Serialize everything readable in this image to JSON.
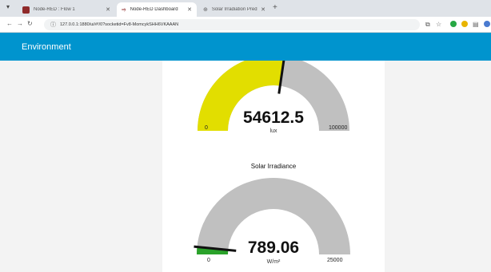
{
  "browser": {
    "tabs": [
      {
        "title": "Node-RED : Flow 1"
      },
      {
        "title": "Node-RED Dashboard"
      },
      {
        "title": "Solar Irradiation Prediction"
      }
    ],
    "url": "127.0.0.1:1880/ui/#!/0?socketid=Fv8-MomcykSHH6VKAAAN"
  },
  "dashboard": {
    "title": "Environment"
  },
  "gauges": [
    {
      "label": "",
      "value": "54612.5",
      "value_num": 54612.5,
      "unit": "lux",
      "min": "0",
      "max": "100000",
      "min_num": 0,
      "max_num": 100000,
      "fill_color": "#e2de00",
      "track_color": "#c0c0c0"
    },
    {
      "label": "Solar Irradiance",
      "value": "789.06",
      "value_num": 789.06,
      "unit": "W/m²",
      "min": "0",
      "max": "25000",
      "min_num": 0,
      "max_num": 25000,
      "fill_color": "#2aa22a",
      "track_color": "#c0c0c0"
    }
  ]
}
